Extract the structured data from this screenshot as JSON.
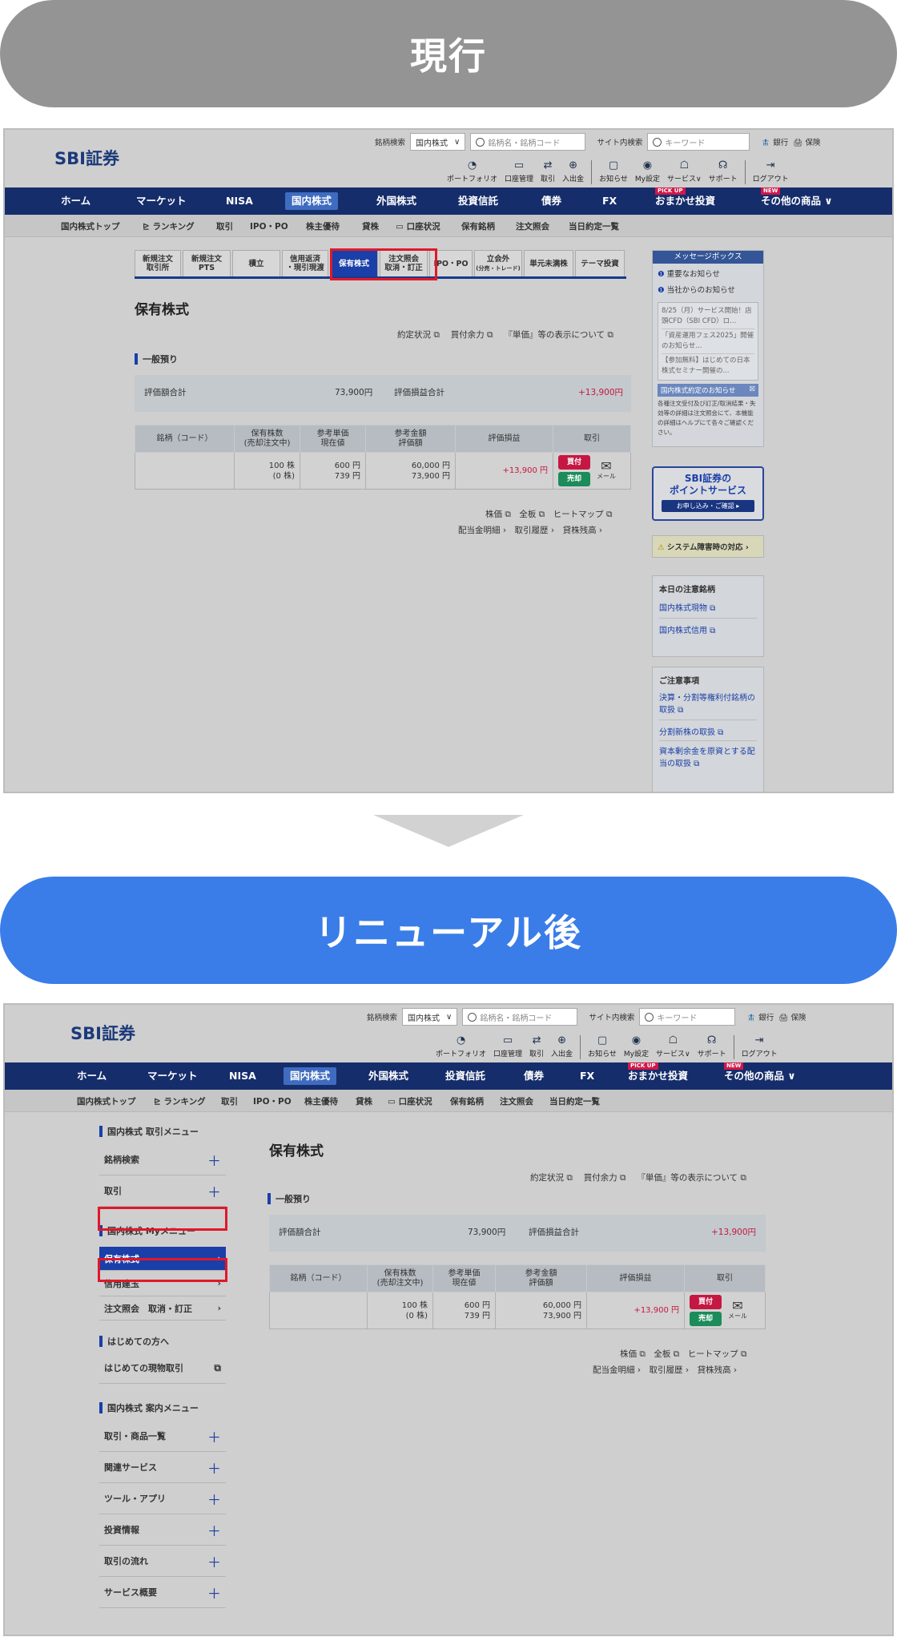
{
  "labels": {
    "current": "現行",
    "renewal": "リニューアル後"
  },
  "header": {
    "logo": "SBI証券",
    "stock_search_label": "銘柄検索",
    "stock_select": "国内株式",
    "stock_placeholder": "銘柄名・銘柄コード",
    "site_search_label": "サイト内検索",
    "site_placeholder": "キーワード",
    "bank": "銀行",
    "insurance": "保険",
    "icons": [
      {
        "label": "ポートフォリオ",
        "icon": "portfolio-icon"
      },
      {
        "label": "口座管理",
        "icon": "account-icon"
      },
      {
        "label": "取引",
        "icon": "trade-icon"
      },
      {
        "label": "入出金",
        "icon": "deposit-icon"
      },
      {
        "label": "お知らせ",
        "icon": "notice-icon"
      },
      {
        "label": "My設定",
        "icon": "mysettings-icon"
      },
      {
        "label": "サービス∨",
        "icon": "service-icon"
      },
      {
        "label": "サポート",
        "icon": "support-icon"
      },
      {
        "label": "ログアウト",
        "icon": "logout-icon"
      }
    ]
  },
  "nav": [
    "ホーム",
    "マーケット",
    "NISA",
    "国内株式",
    "外国株式",
    "投資信託",
    "債券",
    "FX",
    "おまかせ投資",
    "その他の商品"
  ],
  "nav_badges": {
    "pickup": "PICK UP",
    "new": "NEW"
  },
  "subnav": [
    "国内株式トップ",
    "ランキング",
    "取引",
    "IPO・PO",
    "株主優待",
    "貸株",
    "口座状況",
    "保有銘柄",
    "注文照会",
    "当日約定一覧"
  ],
  "tabs": [
    {
      "l1": "新規注文",
      "l2": "取引所"
    },
    {
      "l1": "新規注文",
      "l2": "PTS"
    },
    {
      "l1": "積立",
      "l2": ""
    },
    {
      "l1": "信用返済",
      "l2": "・現引現渡"
    },
    {
      "l1": "保有株式",
      "l2": ""
    },
    {
      "l1": "注文照会",
      "l2": "取消・訂正"
    },
    {
      "l1": "IPO・PO",
      "l2": ""
    },
    {
      "l1": "立会外",
      "l2": "(分売・トレード)"
    },
    {
      "l1": "単元未満株",
      "l2": ""
    },
    {
      "l1": "テーマ投資",
      "l2": ""
    }
  ],
  "page": {
    "title": "保有株式",
    "top_links": [
      "約定状況",
      "買付余力",
      "『単価』等の表示について"
    ],
    "section": "一般預り",
    "eval_total_label": "評価額合計",
    "eval_total": "73,900円",
    "pl_total_label": "評価損益合計",
    "pl_total": "+13,900円",
    "table_headers": [
      {
        "a": "銘柄（コード）",
        "b": ""
      },
      {
        "a": "保有株数",
        "b": "(売却注文中)"
      },
      {
        "a": "参考単価",
        "b": "現在値"
      },
      {
        "a": "参考金額",
        "b": "評価額"
      },
      {
        "a": "評価損益",
        "b": ""
      },
      {
        "a": "取引",
        "b": ""
      }
    ],
    "row": {
      "shares": "100 株",
      "shares_pending": "(0 株)",
      "unit": "600 円",
      "current": "739 円",
      "amount": "60,000 円",
      "value": "73,900 円",
      "pl": "+13,900 円",
      "buy": "買付",
      "sell": "売却",
      "mail": "メール"
    },
    "bottom_links1": [
      "株価",
      "全板",
      "ヒートマップ"
    ],
    "bottom_links2": [
      "配当金明細",
      "取引履歴",
      "貸株残高"
    ]
  },
  "sidebar": {
    "msgbox_title": "メッセージボックス",
    "msg1": "重要なお知らせ",
    "msg2": "当社からのお知らせ",
    "news": [
      "8/25（月）サービス開始！店頭CFD（SBI CFD）ロ...",
      "「資産運用フェス2025」開催のお知らせ...",
      "【参加無料】はじめての日本株式セミナー開催の..."
    ],
    "exec_title": "国内株式約定のお知らせ",
    "exec_text": "各種注文受付及び訂正/取消結果・失効等の詳細は注文照会にて、本機能の詳細はヘルプにて各々ご確認ください。",
    "point_line1": "SBI証券の",
    "point_line2": "ポイントサービス",
    "point_btn": "お申し込み・ご確認",
    "system_alert": "システム障害時の対応",
    "caution_title": "本日の注意銘柄",
    "caution_links": [
      "国内株式現物",
      "国内株式信用"
    ],
    "notes_title": "ご注意事項",
    "notes_links": [
      "決算・分割等権利付銘柄の取扱",
      "分割新株の取扱",
      "資本剰余金を原資とする配当の取扱"
    ]
  },
  "leftmenu": {
    "trade_menu_title": "国内株式 取引メニュー",
    "trade_items": [
      "銘柄検索",
      "取引"
    ],
    "my_menu_title": "国内株式 Myメニュー",
    "my_items": [
      "保有株式",
      "信用建玉",
      "注文照会　取消・訂正"
    ],
    "beginner_title": "はじめての方へ",
    "beginner_items": [
      "はじめての現物取引"
    ],
    "guide_title": "国内株式 案内メニュー",
    "guide_items": [
      "取引・商品一覧",
      "関連サービス",
      "ツール・アプリ",
      "投資情報",
      "取引の流れ",
      "サービス概要"
    ]
  }
}
